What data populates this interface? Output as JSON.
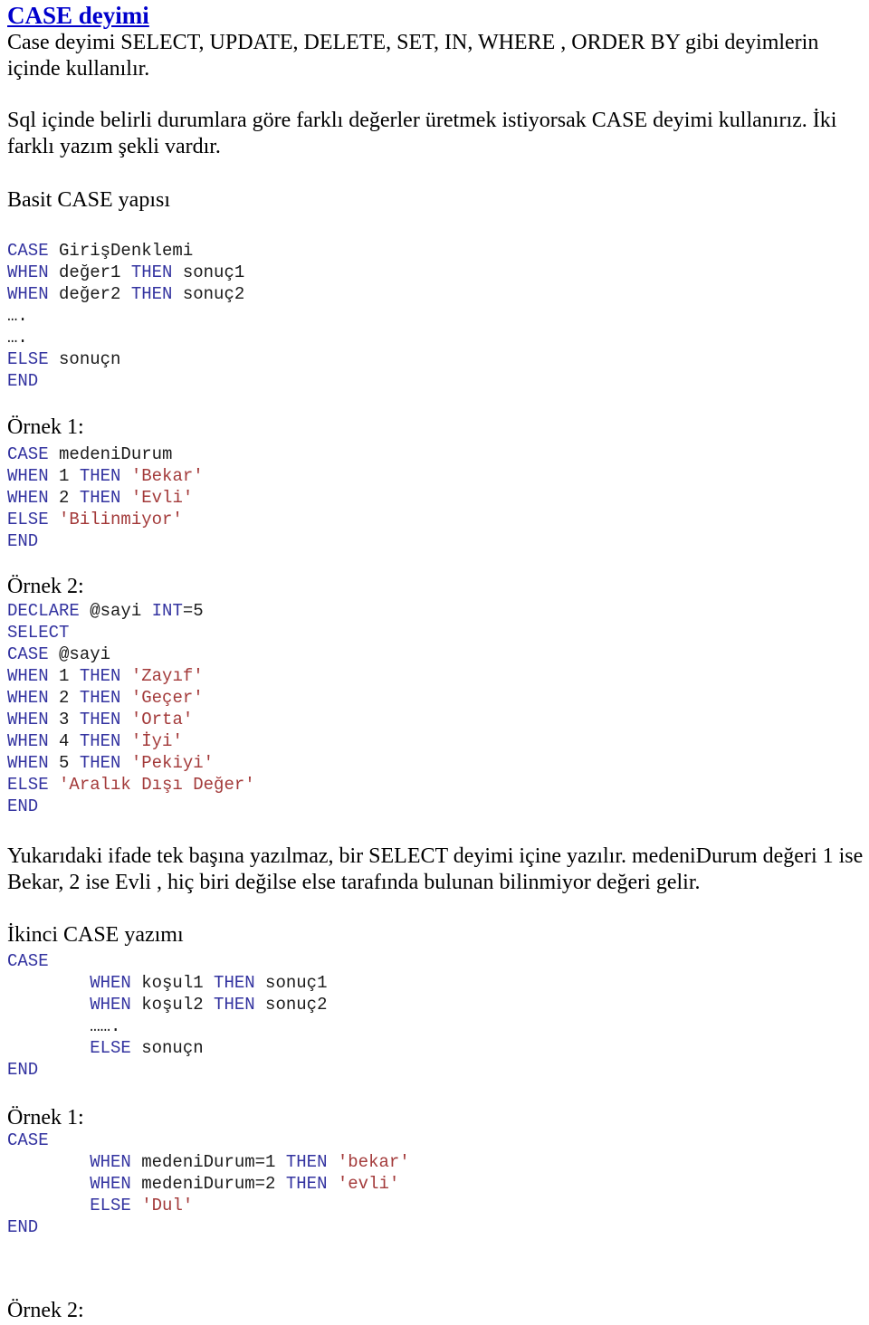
{
  "document": {
    "title": "CASE deyimi",
    "title_color": "#0000cc",
    "keyword_color": "#3333a0",
    "string_color": "#a33a3a",
    "text_color": "#000000"
  },
  "intro": {
    "paragraph1": "Case deyimi SELECT, UPDATE, DELETE, SET, IN, WHERE , ORDER BY gibi deyimlerin içinde kullanılır.",
    "paragraph2": "Sql içinde belirli durumlara göre farklı değerler üretmek istiyorsak CASE deyimi kullanırız. İki farklı yazım şekli vardır."
  },
  "section_basit": {
    "heading": "Basit CASE yapısı",
    "code": [
      [
        {
          "t": "CASE",
          "c": "kw"
        },
        {
          "t": " GirişDenklemi",
          "c": "plain"
        }
      ],
      [
        {
          "t": "WHEN",
          "c": "kw"
        },
        {
          "t": " değer1 ",
          "c": "plain"
        },
        {
          "t": "THEN",
          "c": "kw"
        },
        {
          "t": " sonuç1",
          "c": "plain"
        }
      ],
      [
        {
          "t": "WHEN",
          "c": "kw"
        },
        {
          "t": " değer2 ",
          "c": "plain"
        },
        {
          "t": "THEN",
          "c": "kw"
        },
        {
          "t": " sonuç2",
          "c": "plain"
        }
      ],
      [
        {
          "t": "….",
          "c": "dots"
        }
      ],
      [
        {
          "t": "….",
          "c": "dots"
        }
      ],
      [
        {
          "t": "ELSE",
          "c": "kw"
        },
        {
          "t": " sonuçn",
          "c": "plain"
        }
      ],
      [
        {
          "t": "END",
          "c": "kw"
        }
      ]
    ]
  },
  "section_ornek1": {
    "heading": "Örnek 1:",
    "code": [
      [
        {
          "t": "CASE",
          "c": "kw"
        },
        {
          "t": " medeniDurum",
          "c": "plain"
        }
      ],
      [
        {
          "t": "WHEN",
          "c": "kw"
        },
        {
          "t": " 1 ",
          "c": "plain"
        },
        {
          "t": "THEN",
          "c": "kw"
        },
        {
          "t": " ",
          "c": "plain"
        },
        {
          "t": "'Bekar'",
          "c": "str"
        }
      ],
      [
        {
          "t": "WHEN",
          "c": "kw"
        },
        {
          "t": " 2 ",
          "c": "plain"
        },
        {
          "t": "THEN",
          "c": "kw"
        },
        {
          "t": " ",
          "c": "plain"
        },
        {
          "t": "'Evli'",
          "c": "str"
        }
      ],
      [
        {
          "t": "ELSE",
          "c": "kw"
        },
        {
          "t": " ",
          "c": "plain"
        },
        {
          "t": "'Bilinmiyor'",
          "c": "str"
        }
      ],
      [
        {
          "t": "END",
          "c": "kw"
        }
      ]
    ]
  },
  "section_ornek2": {
    "heading": "Örnek 2:",
    "code": [
      [
        {
          "t": "DECLARE",
          "c": "kw"
        },
        {
          "t": " @sayi ",
          "c": "plain"
        },
        {
          "t": "INT",
          "c": "kw"
        },
        {
          "t": "=5",
          "c": "plain"
        }
      ],
      [
        {
          "t": "SELECT",
          "c": "kw"
        }
      ],
      [
        {
          "t": "CASE",
          "c": "kw"
        },
        {
          "t": " @sayi",
          "c": "plain"
        }
      ],
      [
        {
          "t": "WHEN",
          "c": "kw"
        },
        {
          "t": " 1 ",
          "c": "plain"
        },
        {
          "t": "THEN",
          "c": "kw"
        },
        {
          "t": " ",
          "c": "plain"
        },
        {
          "t": "'Zayıf'",
          "c": "str"
        }
      ],
      [
        {
          "t": "WHEN",
          "c": "kw"
        },
        {
          "t": " 2 ",
          "c": "plain"
        },
        {
          "t": "THEN",
          "c": "kw"
        },
        {
          "t": " ",
          "c": "plain"
        },
        {
          "t": "'Geçer'",
          "c": "str"
        }
      ],
      [
        {
          "t": "WHEN",
          "c": "kw"
        },
        {
          "t": " 3 ",
          "c": "plain"
        },
        {
          "t": "THEN",
          "c": "kw"
        },
        {
          "t": " ",
          "c": "plain"
        },
        {
          "t": "'Orta'",
          "c": "str"
        }
      ],
      [
        {
          "t": "WHEN",
          "c": "kw"
        },
        {
          "t": " 4 ",
          "c": "plain"
        },
        {
          "t": "THEN",
          "c": "kw"
        },
        {
          "t": " ",
          "c": "plain"
        },
        {
          "t": "'İyi'",
          "c": "str"
        }
      ],
      [
        {
          "t": "WHEN",
          "c": "kw"
        },
        {
          "t": " 5 ",
          "c": "plain"
        },
        {
          "t": "THEN",
          "c": "kw"
        },
        {
          "t": " ",
          "c": "plain"
        },
        {
          "t": "'Pekiyi'",
          "c": "str"
        }
      ],
      [
        {
          "t": "ELSE",
          "c": "kw"
        },
        {
          "t": " ",
          "c": "plain"
        },
        {
          "t": "'Aralık Dışı Değer'",
          "c": "str"
        }
      ],
      [
        {
          "t": "END",
          "c": "kw"
        }
      ]
    ]
  },
  "explanation": {
    "text": "Yukarıdaki ifade tek başına yazılmaz, bir SELECT deyimi içine yazılır. medeniDurum değeri 1 ise Bekar, 2 ise Evli , hiç biri değilse else tarafında bulunan bilinmiyor değeri gelir."
  },
  "section_ikinci": {
    "heading": "İkinci CASE yazımı",
    "code": [
      [
        {
          "t": "CASE",
          "c": "kw"
        }
      ],
      [
        {
          "t": "        ",
          "c": "plain"
        },
        {
          "t": "WHEN",
          "c": "kw"
        },
        {
          "t": " koşul1 ",
          "c": "plain"
        },
        {
          "t": "THEN",
          "c": "kw"
        },
        {
          "t": " sonuç1",
          "c": "plain"
        }
      ],
      [
        {
          "t": "        ",
          "c": "plain"
        },
        {
          "t": "WHEN",
          "c": "kw"
        },
        {
          "t": " koşul2 ",
          "c": "plain"
        },
        {
          "t": "THEN",
          "c": "kw"
        },
        {
          "t": " sonuç2",
          "c": "plain"
        }
      ],
      [
        {
          "t": "        ",
          "c": "plain"
        },
        {
          "t": "…….",
          "c": "dots"
        }
      ],
      [
        {
          "t": "        ",
          "c": "plain"
        },
        {
          "t": "ELSE",
          "c": "kw"
        },
        {
          "t": " sonuçn",
          "c": "plain"
        }
      ],
      [
        {
          "t": "END",
          "c": "kw"
        }
      ]
    ]
  },
  "section_ikinci_ornek1": {
    "heading": "Örnek 1:",
    "code": [
      [
        {
          "t": "CASE",
          "c": "kw"
        }
      ],
      [
        {
          "t": "        ",
          "c": "plain"
        },
        {
          "t": "WHEN",
          "c": "kw"
        },
        {
          "t": " medeniDurum=1 ",
          "c": "plain"
        },
        {
          "t": "THEN",
          "c": "kw"
        },
        {
          "t": " ",
          "c": "plain"
        },
        {
          "t": "'bekar'",
          "c": "str"
        }
      ],
      [
        {
          "t": "        ",
          "c": "plain"
        },
        {
          "t": "WHEN",
          "c": "kw"
        },
        {
          "t": " medeniDurum=2 ",
          "c": "plain"
        },
        {
          "t": "THEN",
          "c": "kw"
        },
        {
          "t": " ",
          "c": "plain"
        },
        {
          "t": "'evli'",
          "c": "str"
        }
      ],
      [
        {
          "t": "        ",
          "c": "plain"
        },
        {
          "t": "ELSE",
          "c": "kw"
        },
        {
          "t": " ",
          "c": "plain"
        },
        {
          "t": "'Dul'",
          "c": "str"
        }
      ],
      [
        {
          "t": "END",
          "c": "kw"
        }
      ]
    ]
  },
  "section_ikinci_ornek2": {
    "heading": "Örnek 2:"
  }
}
